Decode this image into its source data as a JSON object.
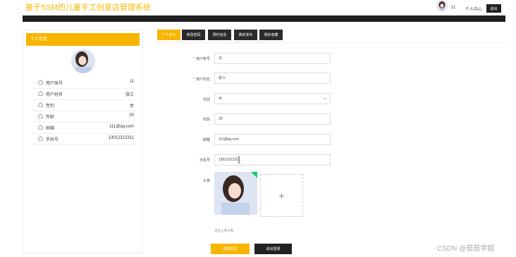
{
  "header": {
    "site_title": "基于SSM的儿童手工创意店管理系统",
    "username": "11",
    "user_center": "个人中心",
    "logout": "退出"
  },
  "panel": {
    "title": "个人信息",
    "rows": [
      {
        "label": "用户账号",
        "value": "11",
        "icon": "home-icon"
      },
      {
        "label": "用户姓名",
        "value": "张三",
        "icon": "home-icon"
      },
      {
        "label": "性别",
        "value": "女",
        "icon": "home-icon"
      },
      {
        "label": "年龄",
        "value": "20",
        "icon": "home-icon"
      },
      {
        "label": "邮箱",
        "value": "111@qq.com",
        "icon": "home-icon"
      },
      {
        "label": "手机号",
        "value": "13012312311",
        "icon": "home-icon"
      }
    ]
  },
  "tabs": [
    {
      "label": "个人中心",
      "active": true
    },
    {
      "label": "修改密码",
      "active": false
    },
    {
      "label": "预约信息",
      "active": false
    },
    {
      "label": "我的发布",
      "active": false
    },
    {
      "label": "我的收藏",
      "active": false
    }
  ],
  "form": {
    "account_label": "用户账号",
    "account_value": "11",
    "name_label": "用户姓名",
    "name_value": "张三",
    "gender_label": "性别",
    "gender_value": "女",
    "age_label": "年龄",
    "age_value": "20",
    "email_label": "邮箱",
    "email_value": "111@qq.com",
    "phone_label": "手机号",
    "phone_value": "13012312311",
    "avatar_label": "头像",
    "upload_symbol": "+",
    "upload_hint": "点击上传头像"
  },
  "buttons": {
    "update": "更新信息",
    "logout": "退出登录"
  },
  "watermark": "CSDN @茹茹学姐",
  "colors": {
    "accent": "#f7b500",
    "dark": "#222222"
  }
}
